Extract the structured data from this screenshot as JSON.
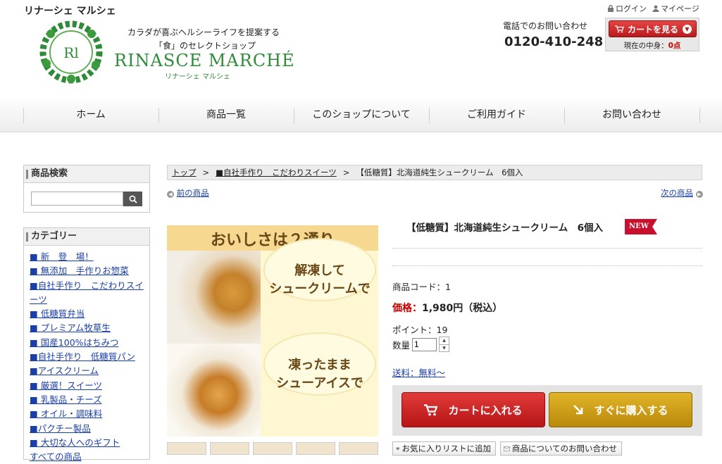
{
  "header": {
    "site_name": "リナーシェ マルシェ",
    "tagline1": "カラダが喜ぶヘルシーライフを提案する",
    "tagline2": "「食」のセレクトショップ",
    "logo_text": "RINASCE MARCHÉ",
    "logo_sub": "リナーシェ マルシェ",
    "login_label": "ログイン",
    "mypage_label": "マイページ",
    "tel_label": "電話でのお問い合わせ",
    "tel_number": "0120-410-248",
    "cart_button_label": "カートを見る",
    "cart_current_label": "現在の中身：",
    "cart_current_value": "0点"
  },
  "nav": {
    "items": [
      {
        "label": "ホーム"
      },
      {
        "label": "商品一覧"
      },
      {
        "label": "このショップについて"
      },
      {
        "label": "ご利用ガイド"
      },
      {
        "label": "お問い合わせ"
      }
    ]
  },
  "sidebar": {
    "search_title": "商品検索",
    "search_value": "",
    "category_title": "カテゴリー",
    "categories": [
      "■ 新　登　場！",
      "■ 無添加　手作りお惣菜",
      "■自社手作り　こだわりスイーツ",
      "■ 低糖質弁当",
      "■ プレミアム牧草生",
      "■ 国産100%はちみつ",
      "■自社手作り　低糖質パン",
      "■アイスクリーム",
      "■ 厳選！スイーツ",
      "■ 乳製品・チーズ",
      "■ オイル・調味料",
      "■パクチー製品",
      "■ 大切な人へのギフト",
      "すべての商品"
    ]
  },
  "breadcrumb": {
    "top": "トップ",
    "category": "■自社手作り　こだわりスイーツ",
    "current": "【低糖質】北海道純生シュークリーム　6個入",
    "separator": ">"
  },
  "pager": {
    "prev": "前の商品",
    "next": "次の商品"
  },
  "product_image": {
    "title": "おいしさは２通り",
    "bubble1": "解凍して\nシュークリームで",
    "bubble2": "凍ったまま\nシューアイスで"
  },
  "product": {
    "title": "【低糖質】北海道純生シュークリーム　6個入",
    "badge": "NEW",
    "code_label": "商品コード：",
    "code_value": "1",
    "price_label": "価格：",
    "price_value": "1,980円（税込）",
    "point_label": "ポイント：",
    "point_value": "19",
    "qty_label": "数量",
    "qty_value": "1",
    "shipping_label": "送料：無料～",
    "add_cart_label": "カートに入れる",
    "buy_now_label": "すぐに購入する",
    "fav_label": "お気に入りリストに追加",
    "inquiry_label": "商品についてのお問い合わせ"
  },
  "colors": {
    "accent_red": "#c8102e",
    "brand_green": "#2f8a3a",
    "buy_gold": "#c99a12"
  }
}
